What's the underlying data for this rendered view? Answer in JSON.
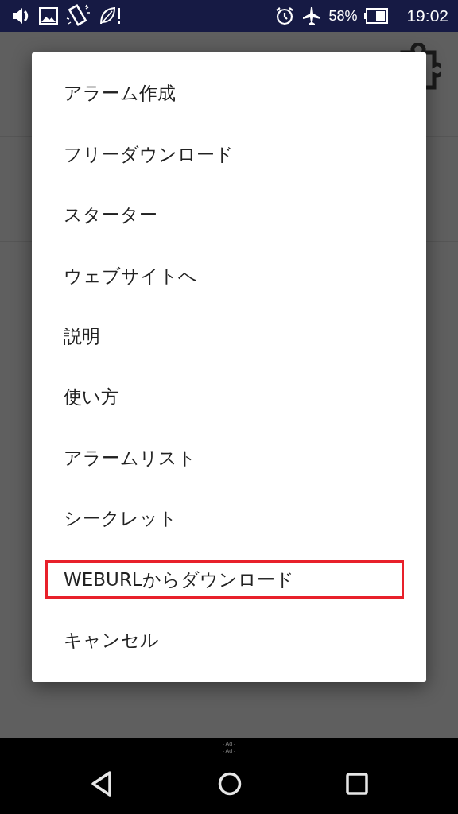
{
  "status_bar": {
    "battery_percent": "58%",
    "time": "19:02"
  },
  "menu": {
    "items": [
      {
        "label": "アラーム作成",
        "highlighted": false
      },
      {
        "label": "フリーダウンロード",
        "highlighted": false
      },
      {
        "label": "スターター",
        "highlighted": false
      },
      {
        "label": "ウェブサイトへ",
        "highlighted": false
      },
      {
        "label": "説明",
        "highlighted": false
      },
      {
        "label": "使い方",
        "highlighted": false
      },
      {
        "label": "アラームリスト",
        "highlighted": false
      },
      {
        "label": "シークレット",
        "highlighted": false
      },
      {
        "label": "WEBURLからダウンロード",
        "highlighted": true
      },
      {
        "label": "キャンセル",
        "highlighted": false
      }
    ]
  },
  "ad_labels": [
    "- Ad -",
    "- Ad -"
  ]
}
